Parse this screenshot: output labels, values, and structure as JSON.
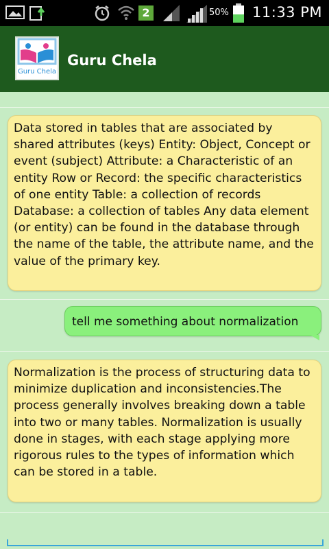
{
  "status_bar": {
    "notification_count": "2",
    "battery_percent": "50%",
    "time": "11:33 PM",
    "icons": [
      "gallery-icon",
      "upload-icon",
      "alarm-icon",
      "wifi-icon",
      "notification-badge-icon",
      "signal-icon",
      "battery-icon"
    ]
  },
  "header": {
    "app_title": "Guru Chela",
    "logo_text": "Guru Chela",
    "colors": {
      "bar": "#1e5a1e",
      "logo_blue": "#2a8fd6",
      "logo_pink": "#e23d8b"
    }
  },
  "messages": [
    {
      "sender": "bot",
      "text": "Data stored in tables that are associated by shared attributes (keys) Entity: Object, Concept or event (subject) Attribute: a Characteristic of an entity Row or Record: the specific characteristics of one entity Table: a collection of records  Database: a collection of tables Any data element (or entity) can be found in the database through the name of the table, the attribute name, and the value of the primary key."
    },
    {
      "sender": "user",
      "text": "tell me something about normalization"
    },
    {
      "sender": "bot",
      "text": "Normalization is the process of structuring data to minimize duplication and inconsistencies.The process generally involves breaking down a table into two or many tables. Normalization is usually done in stages, with each stage applying more rigorous rules to the types of information which can be stored in a table."
    }
  ],
  "colors": {
    "chat_background": "#c6ecc4",
    "bot_bubble": "#fbef9c",
    "user_bubble": "#8af07c",
    "input_underline": "#3aa6d9"
  }
}
